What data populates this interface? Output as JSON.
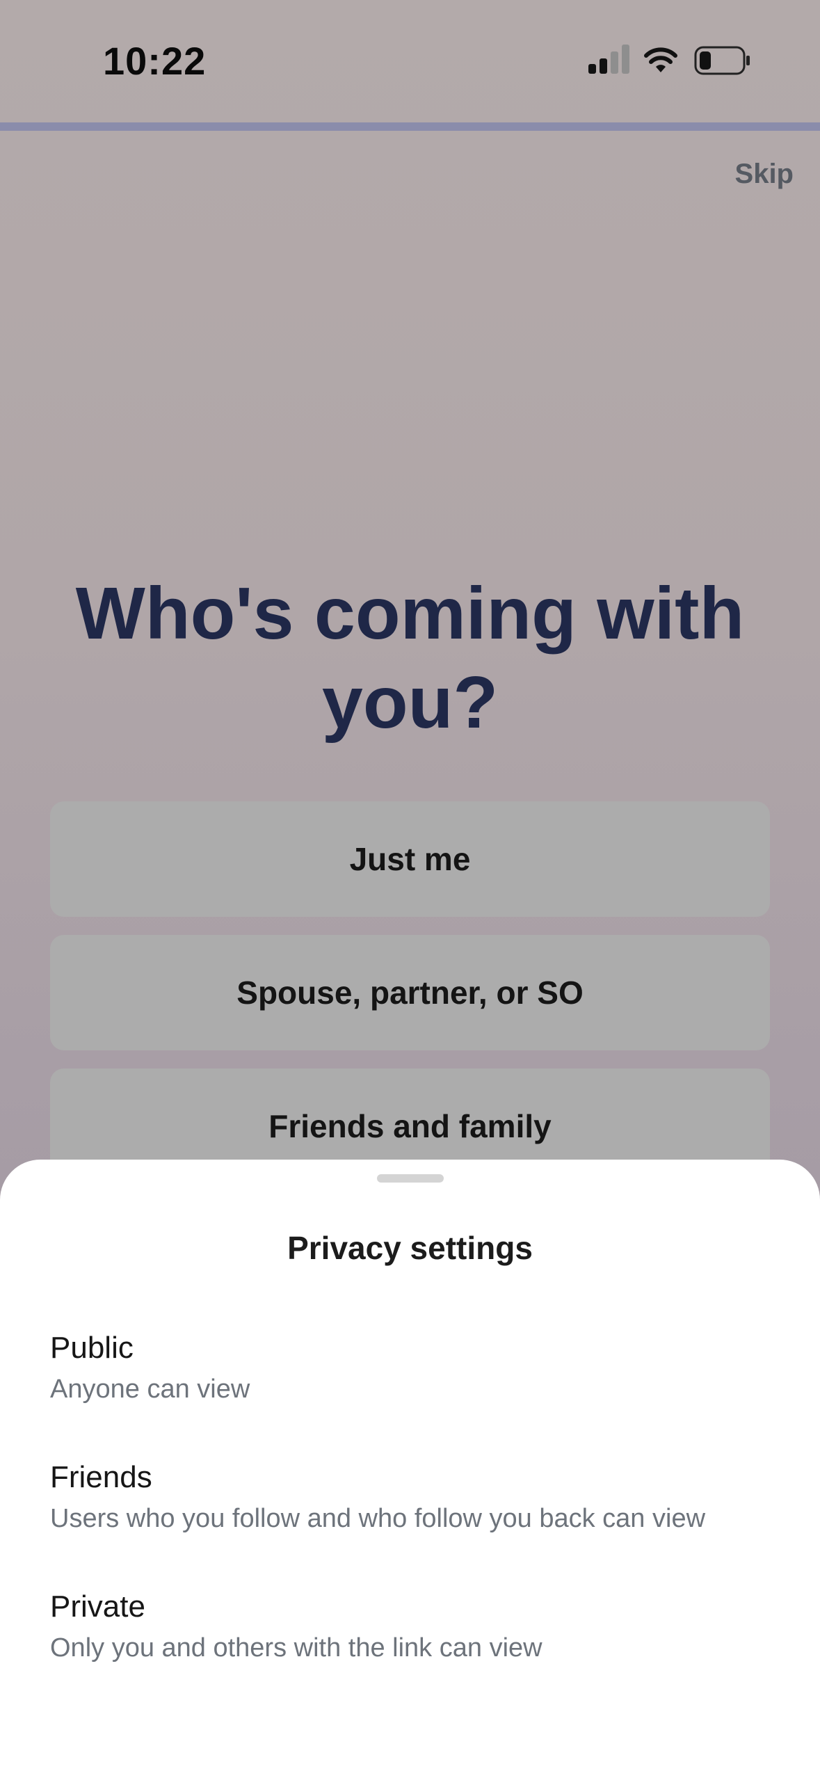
{
  "status_bar": {
    "time": "10:22",
    "icons": [
      "cellular-signal-icon",
      "wifi-icon",
      "battery-icon"
    ]
  },
  "progress": {
    "fraction": 1.0,
    "color": "#8a8cab"
  },
  "header": {
    "skip_label": "Skip"
  },
  "question": {
    "title": "Who's coming with you?"
  },
  "options": [
    {
      "label": "Just me"
    },
    {
      "label": "Spouse, partner, or SO"
    },
    {
      "label": "Friends and family"
    }
  ],
  "privacy_sheet": {
    "title": "Privacy settings",
    "items": [
      {
        "title": "Public",
        "description": "Anyone can view"
      },
      {
        "title": "Friends",
        "description": "Users who you follow and who follow you back can view"
      },
      {
        "title": "Private",
        "description": "Only you and others with the link can view"
      }
    ]
  },
  "colors": {
    "title_text": "#1f2747",
    "sheet_bg": "#ffffff",
    "muted_text": "#6d737b"
  }
}
